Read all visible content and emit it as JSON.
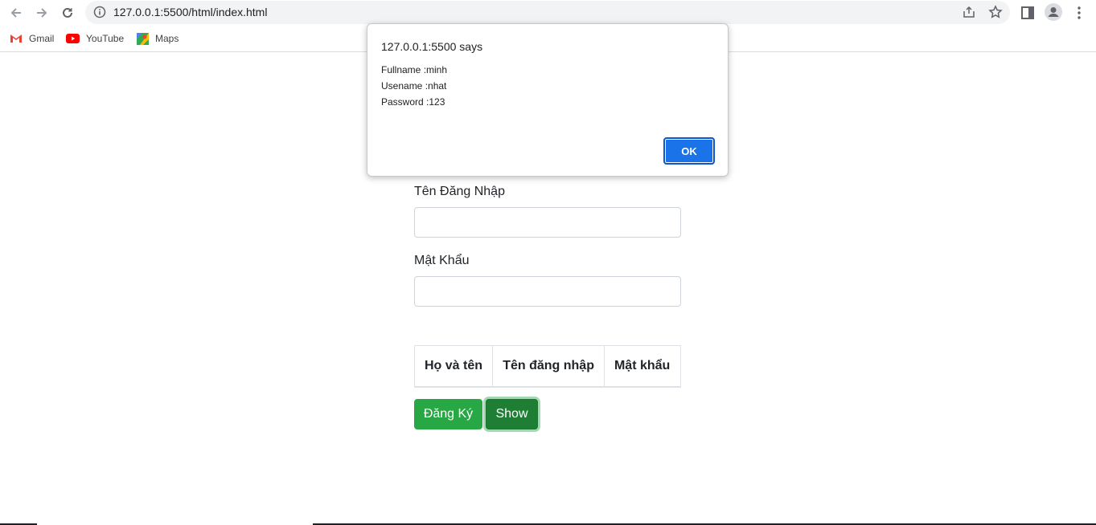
{
  "browser": {
    "url": "127.0.0.1:5500/html/index.html",
    "bookmarks": [
      {
        "label": "Gmail",
        "icon": "gmail-icon"
      },
      {
        "label": "YouTube",
        "icon": "youtube-icon"
      },
      {
        "label": "Maps",
        "icon": "maps-icon"
      }
    ]
  },
  "form": {
    "username_label": "Tên Đăng Nhập",
    "username_value": "",
    "password_label": "Mật Khẩu",
    "password_value": ""
  },
  "table": {
    "headers": [
      "Họ và tên",
      "Tên đăng nhập",
      "Mật khẩu"
    ]
  },
  "buttons": {
    "register": "Đăng Ký",
    "show": "Show"
  },
  "dialog": {
    "title": "127.0.0.1:5500 says",
    "lines": [
      "Fullname :minh",
      "Usename :nhat",
      "Password :123"
    ],
    "ok": "OK"
  },
  "colors": {
    "success": "#28a745",
    "success_active": "#1e7e34",
    "dialog_ok": "#1a73e8"
  }
}
